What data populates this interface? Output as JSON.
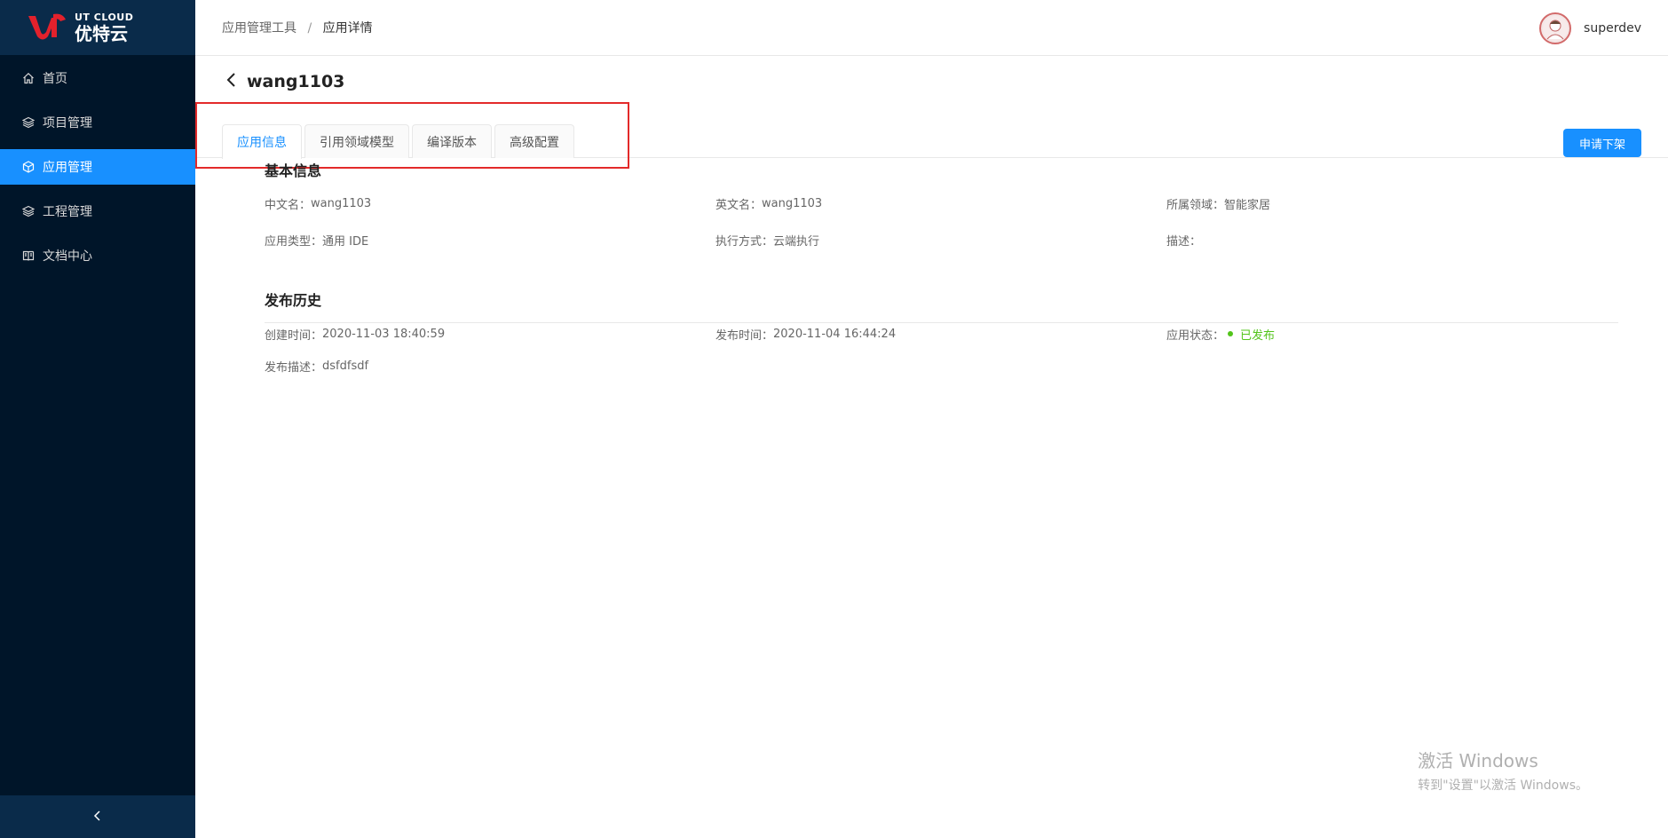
{
  "logo": {
    "en": "UT CLOUD",
    "cn": "优特云",
    "brand_color": "#e3212c"
  },
  "sidebar": {
    "items": [
      {
        "label": "首页",
        "icon": "home-icon",
        "active": false
      },
      {
        "label": "项目管理",
        "icon": "layers-icon",
        "active": false
      },
      {
        "label": "应用管理",
        "icon": "cube-icon",
        "active": true
      },
      {
        "label": "工程管理",
        "icon": "layers-icon",
        "active": false
      },
      {
        "label": "文档中心",
        "icon": "book-icon",
        "active": false
      }
    ],
    "collapse_icon": "chevron-left-icon"
  },
  "header": {
    "breadcrumb": [
      "应用管理工具",
      "应用详情"
    ],
    "separator": "/",
    "username": "superdev"
  },
  "page": {
    "title": "wang1103",
    "tabs": [
      "应用信息",
      "引用领域模型",
      "编译版本",
      "高级配置"
    ],
    "active_tab": 0,
    "action_button": "申请下架"
  },
  "basic_info": {
    "title": "基本信息",
    "fields": [
      {
        "label": "中文名：",
        "value": "wang1103"
      },
      {
        "label": "英文名：",
        "value": "wang1103"
      },
      {
        "label": "所属领域：",
        "value": "智能家居"
      },
      {
        "label": "应用类型：",
        "value": "通用 IDE"
      },
      {
        "label": "执行方式：",
        "value": "云端执行"
      },
      {
        "label": "描述：",
        "value": ""
      }
    ]
  },
  "publish_history": {
    "title": "发布历史",
    "created_label": "创建时间：",
    "created_value": "2020-11-03 18:40:59",
    "published_label": "发布时间：",
    "published_value": "2020-11-04 16:44:24",
    "status_label": "应用状态：",
    "status_value": "已发布",
    "status_color": "#52c41a",
    "desc_label": "发布描述：",
    "desc_value": "dsfdfsdf"
  },
  "watermark": {
    "line1": "激活 Windows",
    "line2": "转到\"设置\"以激活 Windows。"
  },
  "colors": {
    "sidebar_bg": "#001529",
    "active": "#1890ff",
    "highlight": "#e32a2a"
  }
}
